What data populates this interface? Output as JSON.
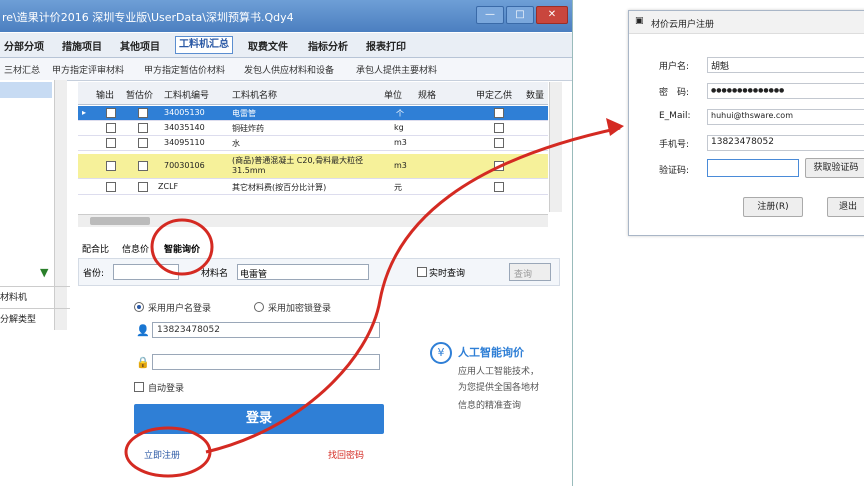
{
  "main_window": {
    "title": "re\\造果计价2016 深圳专业版\\UserData\\深圳预算书.Qdy4",
    "buttons": {
      "minimize": "—",
      "maximize": "□",
      "close": "✕"
    }
  },
  "menu": [
    "分部分项",
    "措施项目",
    "其他项目",
    "工料机汇总",
    "取费文件",
    "指标分析",
    "报表打印"
  ],
  "active_menu": "工料机汇总",
  "subtabs": [
    "三材汇总",
    "甲方指定评审材料",
    "甲方指定暂估价材料",
    "发包人供应材料和设备",
    "承包人提供主要材料"
  ],
  "grid": {
    "headers": [
      "输出",
      "暂估价",
      "工料机编号",
      "工料机名称",
      "单位",
      "规格",
      "甲定乙供",
      "数量"
    ],
    "rows": [
      {
        "code": "34005130",
        "name": "电雷管",
        "unit": "个",
        "state": "selected"
      },
      {
        "code": "34035140",
        "name": "铜硅炸药",
        "unit": "kg",
        "state": "normal"
      },
      {
        "code": "34095110",
        "name": "水",
        "unit": "m3",
        "state": "normal"
      },
      {
        "code": "70030106",
        "name": "(商品)普通混凝土 C20,骨料最大粒径31.5mm",
        "unit": "m3",
        "state": "highlight"
      },
      {
        "code": "ZCLF",
        "name": "其它材料费(按百分比计算)",
        "unit": "元",
        "state": "normal"
      }
    ]
  },
  "left_panel": {
    "items": [
      "材料机",
      "分解类型"
    ]
  },
  "lower_tabs": [
    "配合比",
    "信息价",
    "智能询价"
  ],
  "active_lower_tab": "智能询价",
  "search": {
    "province_label": "省份:",
    "material_label": "材料名",
    "material_value": "电雷管",
    "realtime_label": "实时查询",
    "query_button": "查询"
  },
  "login": {
    "radio_user": "采用用户名登录",
    "radio_lock": "采用加密锁登录",
    "username_value": "13823478052",
    "auto_login": "自动登录",
    "login_button": "登录",
    "register_link": "立即注册",
    "forgot_link": "找回密码"
  },
  "ai_panel": {
    "title": "人工智能询价",
    "line1": "应用人工智能技术，",
    "line2": "为您提供全国各地材",
    "line3": "信息的精准查询"
  },
  "dialog": {
    "title": "材价云用户注册",
    "fields": [
      {
        "label": "用户名:",
        "value": "胡魁"
      },
      {
        "label": "密　码:",
        "value": "●●●●●●●●●●●●●●"
      },
      {
        "label": "E_Mail:",
        "value": "huhui@thsware.com"
      },
      {
        "label": "手机号:",
        "value": "13823478052"
      },
      {
        "label": "验证码:",
        "value": ""
      }
    ],
    "get_code_button": "获取验证码",
    "register_button": "注册(R)",
    "exit_button": "退出"
  },
  "colors": {
    "accent": "#2f7fd6",
    "annotation": "#d42a22",
    "highlight_row": "#f6f19a"
  }
}
